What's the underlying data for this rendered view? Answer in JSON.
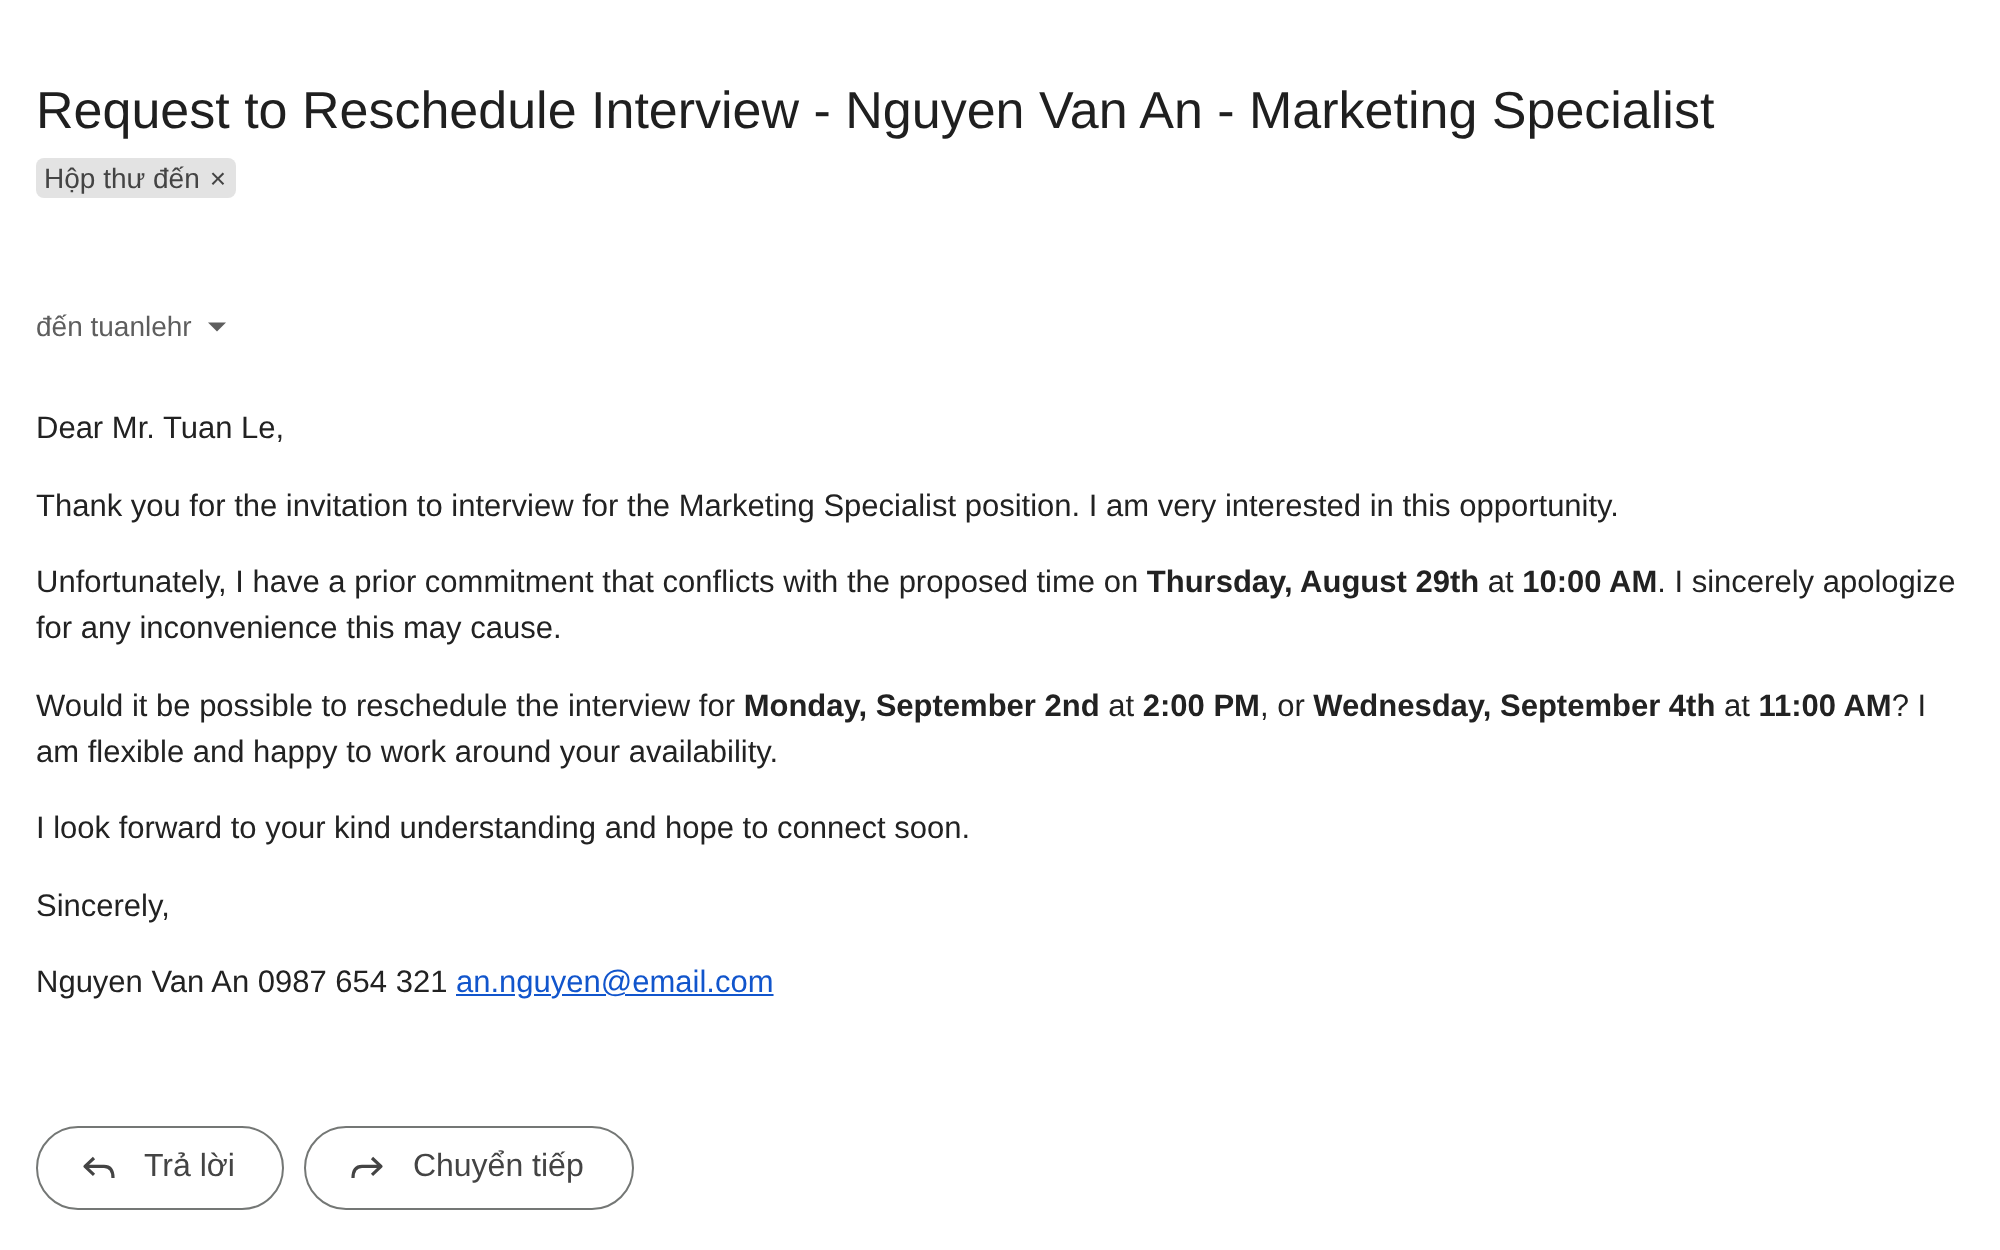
{
  "subject": "Request to Reschedule Interview - Nguyen Van An - Marketing Specialist",
  "labels": [
    {
      "text": "Hộp thư đến",
      "remove": "×"
    }
  ],
  "recipient": {
    "text": "đến tuanlehr"
  },
  "body": {
    "paragraphs": [
      "Dear Mr. Tuan Le,",
      "Thank you for the invitation to interview for the Marketing Specialist position. I am very interested in this opportunity.",
      "Unfortunately, I have a prior commitment that conflicts with the proposed time on **Thursday, August 29th** at **10:00 AM**. I sincerely apologize for any inconvenience this may cause.",
      "Would it be possible to reschedule the interview for **Monday, September 2nd** at **2:00 PM**, or **Wednesday, September 4th** at **11:00 AM**? I am flexible and happy to work around your availability.",
      "I look forward to your kind understanding and hope to connect soon.",
      "Sincerely,"
    ],
    "signature": {
      "text": "Nguyen Van An 0987 654 321",
      "email": "an.nguyen@email.com"
    }
  },
  "actions": [
    {
      "kind": "reply",
      "label": "Trả lời"
    },
    {
      "kind": "forward",
      "label": "Chuyển tiếp"
    }
  ]
}
